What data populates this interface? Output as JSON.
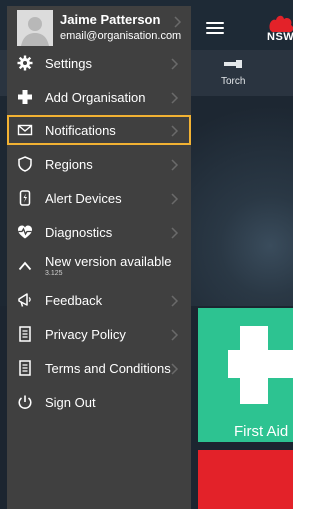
{
  "profile": {
    "name": "Jaime Patterson",
    "email": "email@organisation.com",
    "icon": "avatar-placeholder"
  },
  "menu": {
    "items": [
      {
        "label": "Settings",
        "icon": "gear-icon",
        "chevron": true
      },
      {
        "label": "Add Organisation",
        "icon": "plus-icon",
        "chevron": true
      },
      {
        "label": "Notifications",
        "icon": "envelope-icon",
        "chevron": true,
        "highlighted": true
      },
      {
        "label": "Regions",
        "icon": "shield-icon",
        "chevron": true
      },
      {
        "label": "Alert Devices",
        "icon": "beacon-icon",
        "chevron": true
      },
      {
        "label": "Diagnostics",
        "icon": "heartbeat-icon",
        "chevron": true
      },
      {
        "label": "New version available",
        "sublabel": "3.125",
        "icon": "caret-up-icon",
        "chevron": false
      },
      {
        "label": "Feedback",
        "icon": "megaphone-icon",
        "chevron": true
      },
      {
        "label": "Privacy Policy",
        "icon": "document-icon",
        "chevron": true
      },
      {
        "label": "Terms and Conditions",
        "icon": "document-icon",
        "chevron": true
      },
      {
        "label": "Sign Out",
        "icon": "power-icon",
        "chevron": false
      }
    ]
  },
  "background_app": {
    "toolbar": {
      "torch_label": "Torch"
    },
    "logo_text": "NSW",
    "tiles": {
      "first_aid_label": "First Aid"
    }
  },
  "colors": {
    "drawer_bg": "#404040",
    "highlight": "#f2b233",
    "first_aid_green": "#2dc391",
    "alert_red": "#e32229"
  }
}
